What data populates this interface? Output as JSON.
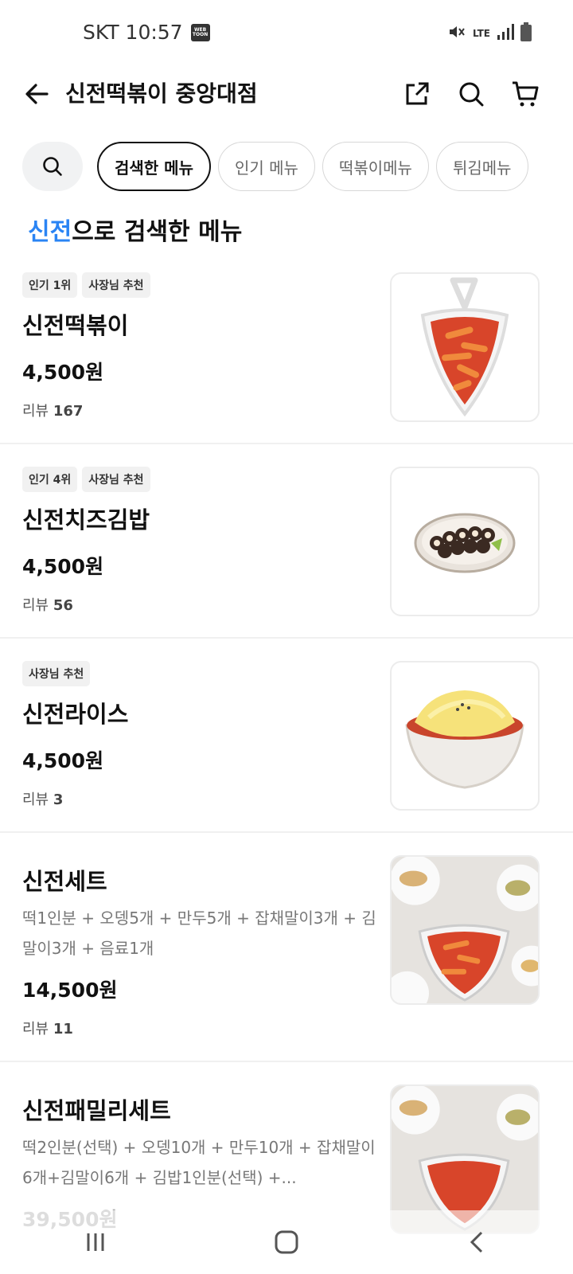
{
  "status": {
    "carrier_time": "SKT 10:57",
    "webtoon_badge": "WEB TOON",
    "network": "LTE"
  },
  "header": {
    "store_name": "신전떡볶이 중앙대점"
  },
  "chips": [
    {
      "label": "검색한 메뉴",
      "active": true
    },
    {
      "label": "인기 메뉴",
      "active": false
    },
    {
      "label": "떡볶이메뉴",
      "active": false
    },
    {
      "label": "튀김메뉴",
      "active": false
    }
  ],
  "section": {
    "keyword": "신전",
    "suffix": "으로 검색한 메뉴"
  },
  "items": [
    {
      "badges": [
        "인기 1위",
        "사장님 추천"
      ],
      "name": "신전떡볶이",
      "desc": "",
      "price": "4,500원",
      "review_label": "리뷰",
      "review_count": "167",
      "image": "tteokbokki-tray"
    },
    {
      "badges": [
        "인기 4위",
        "사장님 추천"
      ],
      "name": "신전치즈김밥",
      "desc": "",
      "price": "4,500원",
      "review_label": "리뷰",
      "review_count": "56",
      "image": "cheese-kimbap-plate"
    },
    {
      "badges": [
        "사장님 추천"
      ],
      "name": "신전라이스",
      "desc": "",
      "price": "4,500원",
      "review_label": "리뷰",
      "review_count": "3",
      "image": "cheese-rice-bowl"
    },
    {
      "badges": [],
      "name": "신전세트",
      "desc": "떡1인분 + 오뎅5개 + 만두5개 + 잡채말이3개 + 김말이3개 + 음료1개",
      "price": "14,500원",
      "review_label": "리뷰",
      "review_count": "11",
      "image": "set-spread"
    },
    {
      "badges": [],
      "name": "신전패밀리세트",
      "desc": "떡2인분(선택) + 오뎅10개 + 만두10개 + 잡채말이6개+김말이6개 + 김밥1인분(선택) +...",
      "price": "39,500원",
      "review_label": "",
      "review_count": "",
      "image": "set-spread"
    }
  ],
  "colors": {
    "accent": "#2a84f4",
    "text": "#111111",
    "muted": "#777777",
    "chip_bg": "#f1f2f3"
  }
}
